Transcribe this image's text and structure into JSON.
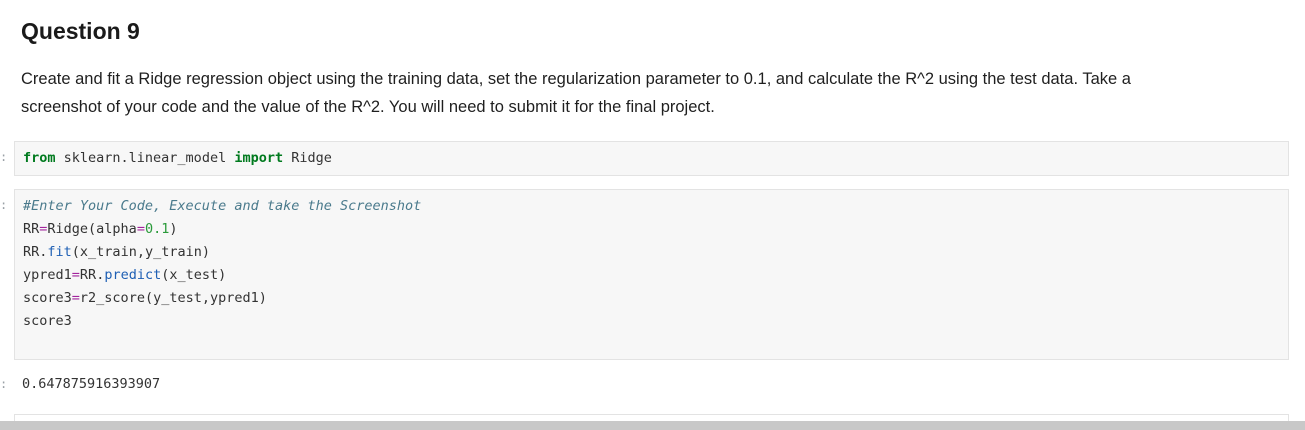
{
  "markdown": {
    "title": "Question 9",
    "paragraph": "Create and fit a Ridge regression object using the training data, set the regularization parameter to 0.1, and calculate the R^2 using the test data. Take a screenshot of your code and the value of the R^2. You will need to submit it for the final project."
  },
  "cells": {
    "prompt_symbol": ":",
    "import_cell": {
      "kw_from": "from",
      "module": " sklearn.linear_model ",
      "kw_import": "import",
      "name": " Ridge"
    },
    "code_cell": {
      "comment": "#Enter Your Code, Execute and take the Screenshot",
      "l2_a": "RR",
      "l2_eq": "=",
      "l2_b": "Ridge(alpha",
      "l2_eq2": "=",
      "l2_num": "0.1",
      "l2_c": ")",
      "l3_a": "RR",
      "l3_dot": ".",
      "l3_attr": "fit",
      "l3_b": "(x_train,y_train)",
      "l4_a": "ypred1",
      "l4_eq": "=",
      "l4_b": "RR",
      "l4_dot": ".",
      "l4_attr": "predict",
      "l4_c": "(x_test)",
      "l5_a": "score3",
      "l5_eq": "=",
      "l5_b": "r2_score(y_test,ypred1)",
      "l6": "score3"
    },
    "output_value": "0.647875916393907"
  }
}
